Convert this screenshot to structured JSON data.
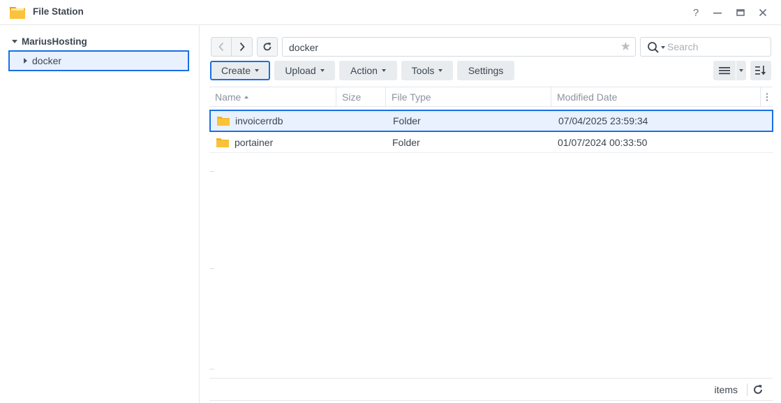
{
  "window": {
    "title": "File Station",
    "help_label": "?"
  },
  "sidebar": {
    "root_label": "MariusHosting",
    "items": [
      {
        "label": "docker"
      }
    ]
  },
  "toolbar": {
    "path": "docker",
    "search_placeholder": "Search",
    "buttons": {
      "create": "Create",
      "upload": "Upload",
      "action": "Action",
      "tools": "Tools",
      "settings": "Settings"
    }
  },
  "table": {
    "headers": {
      "name": "Name",
      "size": "Size",
      "type": "File Type",
      "date": "Modified Date"
    },
    "rows": [
      {
        "name": "invoicerrdb",
        "size": "",
        "type": "Folder",
        "date": "07/04/2025 23:59:34",
        "icon": "folder-icon"
      },
      {
        "name": "portainer",
        "size": "",
        "type": "Folder",
        "date": "01/07/2024 00:33:50",
        "icon": "folder-icon"
      }
    ]
  },
  "footer": {
    "count_label": "items"
  },
  "colors": {
    "accent": "#1a6fe6",
    "selection": "#e8f1fd",
    "folder": "#f8c23a"
  }
}
